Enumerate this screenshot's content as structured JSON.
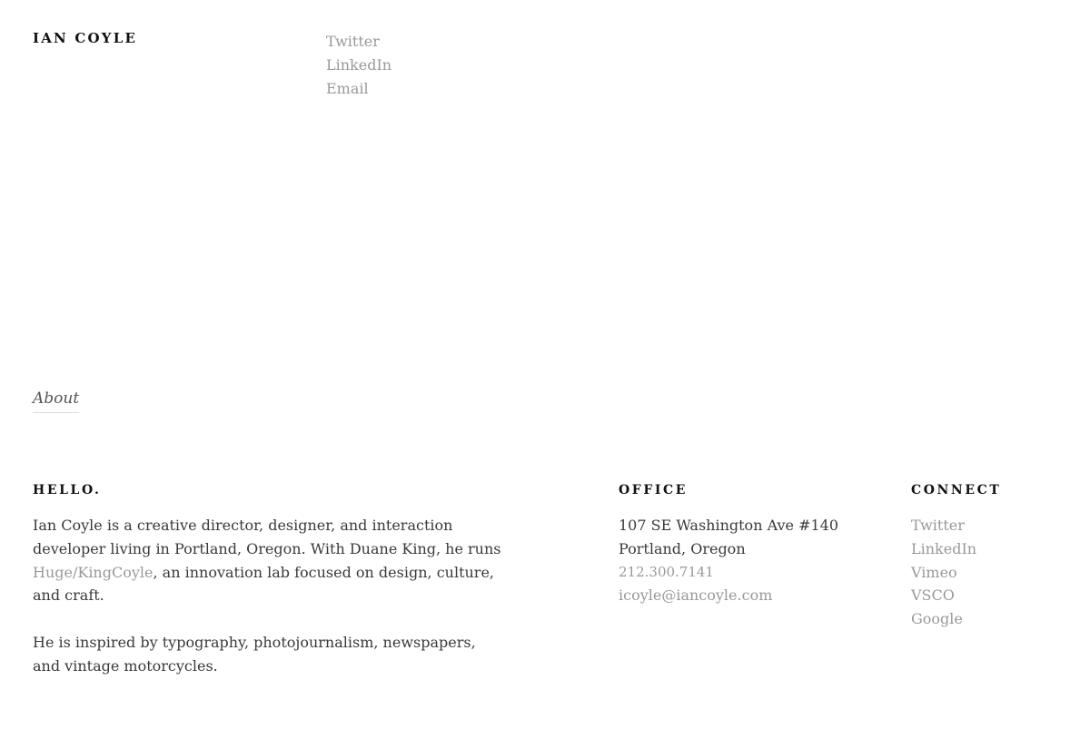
{
  "header": {
    "site_title": "IAN COYLE",
    "links": [
      "Twitter",
      "LinkedIn",
      "Email"
    ]
  },
  "nav": {
    "about_label": "About"
  },
  "hello": {
    "heading": "HELLO.",
    "p1_before": "Ian Coyle is a creative director, designer, and interaction developer living in Portland, Oregon. With Duane King, he runs ",
    "p1_link": "Huge/KingCoyle",
    "p1_after": ", an innovation lab focused on design, culture, and craft.",
    "p2": "He is inspired by typography, photojournalism, newspapers, and vintage motorcycles."
  },
  "office": {
    "heading": "OFFICE",
    "address_line1": "107 SE Washington Ave #140",
    "address_line2": "Portland, Oregon",
    "phone": "212.300.7141",
    "email": "icoyle@iancoyle.com"
  },
  "connect": {
    "heading": "CONNECT",
    "links": [
      "Twitter",
      "LinkedIn",
      "Vimeo",
      "VSCO",
      "Google"
    ]
  },
  "colors": {
    "text": "#3a3a3a",
    "heading": "#111111",
    "link": "#999999",
    "background": "#ffffff"
  }
}
